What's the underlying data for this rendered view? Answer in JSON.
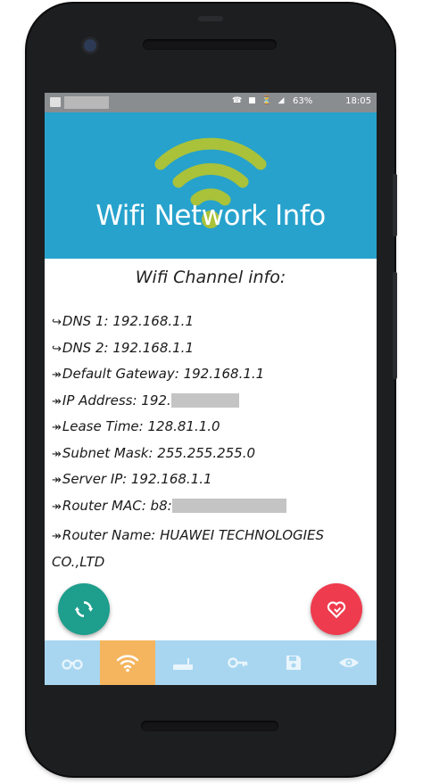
{
  "status_bar": {
    "notification_icons": "☎ ■ ⏳ ◢",
    "battery": "63%",
    "time": "18:05"
  },
  "app": {
    "title": "Wifi Network Info",
    "section_title": "Wifi Channel info:"
  },
  "info_rows": [
    {
      "arrow": "↪",
      "text": "DNS 1: 192.168.1.1"
    },
    {
      "arrow": "↪",
      "text": "DNS 2: 192.168.1.1"
    },
    {
      "arrow": "↠",
      "text": "Default Gateway: 192.168.1.1"
    },
    {
      "arrow": "↠",
      "text": "IP Address: 192."
    },
    {
      "arrow": "↠",
      "text": "Lease Time: 128.81.1.0"
    },
    {
      "arrow": "↠",
      "text": "Subnet Mask: 255.255.255.0"
    },
    {
      "arrow": "↠",
      "text": "Server IP: 192.168.1.1"
    },
    {
      "arrow": "↠",
      "text": "Router MAC: b8:"
    },
    {
      "arrow": "↠",
      "text": "Router Name: HUAWEI TECHNOLOGIES CO.,LTD"
    }
  ],
  "fabs": {
    "refresh_icon": "refresh-icon",
    "love_icon": "heart-icon"
  },
  "bottom_nav": [
    {
      "icon": "binoculars-icon",
      "active": false
    },
    {
      "icon": "wifi-icon",
      "active": true
    },
    {
      "icon": "router-icon",
      "active": false
    },
    {
      "icon": "key-icon",
      "active": false
    },
    {
      "icon": "save-icon",
      "active": false
    },
    {
      "icon": "eye-icon",
      "active": false
    }
  ],
  "colors": {
    "header": "#27a2cc",
    "logo": "#a9c23a",
    "nav_bg": "#a8d6f0",
    "nav_active": "#f5b55f",
    "fab_refresh": "#1e9e8c",
    "fab_love": "#ef3b4e"
  }
}
